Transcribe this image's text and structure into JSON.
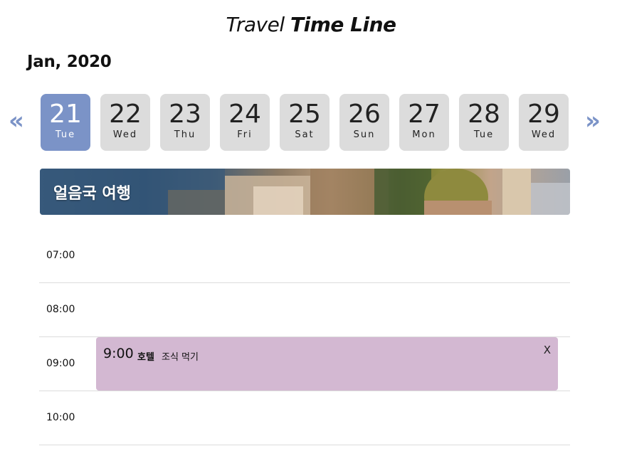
{
  "header": {
    "title_light": "Travel",
    "title_bold": "Time Line"
  },
  "month": "Jan, 2020",
  "nav": {
    "prev": "«",
    "next": "»"
  },
  "days": [
    {
      "num": "21",
      "weekday": "Tue",
      "selected": true
    },
    {
      "num": "22",
      "weekday": "Wed",
      "selected": false
    },
    {
      "num": "23",
      "weekday": "Thu",
      "selected": false
    },
    {
      "num": "24",
      "weekday": "Fri",
      "selected": false
    },
    {
      "num": "25",
      "weekday": "Sat",
      "selected": false
    },
    {
      "num": "26",
      "weekday": "Sun",
      "selected": false
    },
    {
      "num": "27",
      "weekday": "Mon",
      "selected": false
    },
    {
      "num": "28",
      "weekday": "Tue",
      "selected": false
    },
    {
      "num": "29",
      "weekday": "Wed",
      "selected": false
    }
  ],
  "colors": {
    "accent": "#7b93c7",
    "day_bg": "#dcdcdc",
    "event_bg": "#d3b8d2"
  },
  "banner": {
    "title": "얼음국 여행"
  },
  "timeline": {
    "slots": [
      "07:00",
      "08:00",
      "09:00",
      "10:00"
    ]
  },
  "event": {
    "time": "9:00",
    "place": "호텔",
    "description": "조식 먹기",
    "close": "X"
  }
}
